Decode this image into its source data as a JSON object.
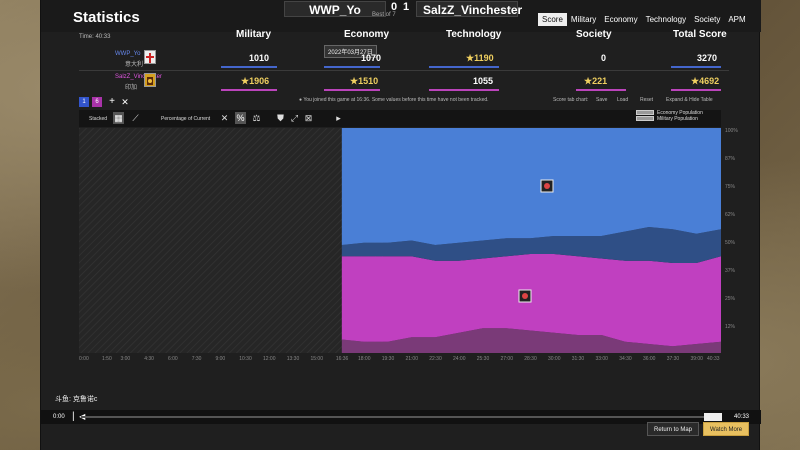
{
  "header": {
    "title": "Statistics",
    "player1": "WWP_Yo",
    "player2": "SalzZ_Vinchester",
    "score1": "0",
    "score2": "1",
    "best_of": "Best of 7",
    "tabs": [
      "Score",
      "Military",
      "Economy",
      "Technology",
      "Society",
      "APM"
    ],
    "active_tab": "Score"
  },
  "table": {
    "time": "Time: 40:33",
    "date": "2022年03月27日",
    "columns": [
      "Military",
      "Economy",
      "Technology",
      "Society",
      "Total Score"
    ],
    "rows": [
      {
        "name": "WWP_Yo",
        "civ": "意大利",
        "color": "#5577dd",
        "values": [
          "1010",
          "1070",
          "1190",
          "0",
          "3270"
        ],
        "stars": [
          false,
          false,
          true,
          false,
          false
        ]
      },
      {
        "name": "SalzZ_Vinchester",
        "civ": "印加",
        "color": "#cc44cc",
        "values": [
          "1906",
          "1510",
          "1055",
          "221",
          "4692"
        ],
        "stars": [
          true,
          true,
          false,
          true,
          true
        ]
      }
    ]
  },
  "toolbar": {
    "notice": "You joined this game at 16:36. Some values before this time have not been tracked.",
    "tab_chart_label": "Score tab chart:",
    "save_label": "Save",
    "load_label": "Load",
    "reset_label": "Reset",
    "expand_label": "Expand & Hide Table",
    "stacked_label": "Stacked",
    "percentage_label": "Percentage of Current",
    "pill_1": "1",
    "pill_2": "6"
  },
  "legend": [
    "Economy Population",
    "Military Population"
  ],
  "chart_data": {
    "type": "area",
    "stacked": true,
    "percentage": true,
    "untracked_until": "16:36",
    "x_ticks": [
      "0:00",
      "1:50",
      "3:00",
      "4:30",
      "6:00",
      "7:30",
      "9:00",
      "10:30",
      "12:00",
      "13:30",
      "15:00",
      "16:36",
      "18:00",
      "19:30",
      "21:00",
      "22:30",
      "24:00",
      "25:30",
      "27:00",
      "28:30",
      "30:00",
      "31:30",
      "33:00",
      "34:30",
      "36:00",
      "37:30",
      "39:00",
      "40:33"
    ],
    "y_ticks": [
      "100%",
      "87%",
      "75%",
      "62%",
      "50%",
      "37%",
      "25%",
      "12%"
    ],
    "x": [
      "16:36",
      "18:00",
      "19:30",
      "21:00",
      "22:30",
      "24:00",
      "25:30",
      "27:00",
      "28:30",
      "30:00",
      "31:30",
      "33:00",
      "34:30",
      "36:00",
      "37:30",
      "39:00",
      "40:33"
    ],
    "series": [
      {
        "name": "Economy Population",
        "player": "WWP_Yo",
        "color": "#4a7fd6",
        "values": [
          52,
          51,
          51,
          50,
          52,
          51,
          50,
          49,
          49,
          48,
          48,
          48,
          46,
          44,
          45,
          47,
          45
        ]
      },
      {
        "name": "Military Population",
        "player": "WWP_Yo",
        "color": "#2f4f86",
        "values": [
          5,
          6,
          6,
          7,
          7,
          8,
          8,
          8,
          7,
          8,
          9,
          10,
          13,
          15,
          15,
          13,
          12
        ]
      },
      {
        "name": "Economy Population",
        "player": "SalzZ_Vinchester",
        "color": "#c040c0",
        "values": [
          37,
          38,
          38,
          36,
          34,
          32,
          31,
          32,
          34,
          35,
          35,
          34,
          36,
          37,
          37,
          36,
          38
        ]
      },
      {
        "name": "Military Population",
        "player": "SalzZ_Vinchester",
        "color": "#7a3a78",
        "values": [
          6,
          5,
          5,
          7,
          7,
          9,
          11,
          11,
          10,
          9,
          8,
          8,
          5,
          4,
          3,
          4,
          5
        ]
      }
    ]
  },
  "chat": "斗鱼: 克鲁诺c",
  "timeline": {
    "start": "0:00",
    "end": "40:33"
  },
  "buttons": {
    "return": "Return to Map",
    "watch": "Watch More"
  },
  "colors": {
    "p1": "#5577dd",
    "p2": "#cc44cc",
    "gold": "#f0d060",
    "accent_button": "#e8c060"
  }
}
